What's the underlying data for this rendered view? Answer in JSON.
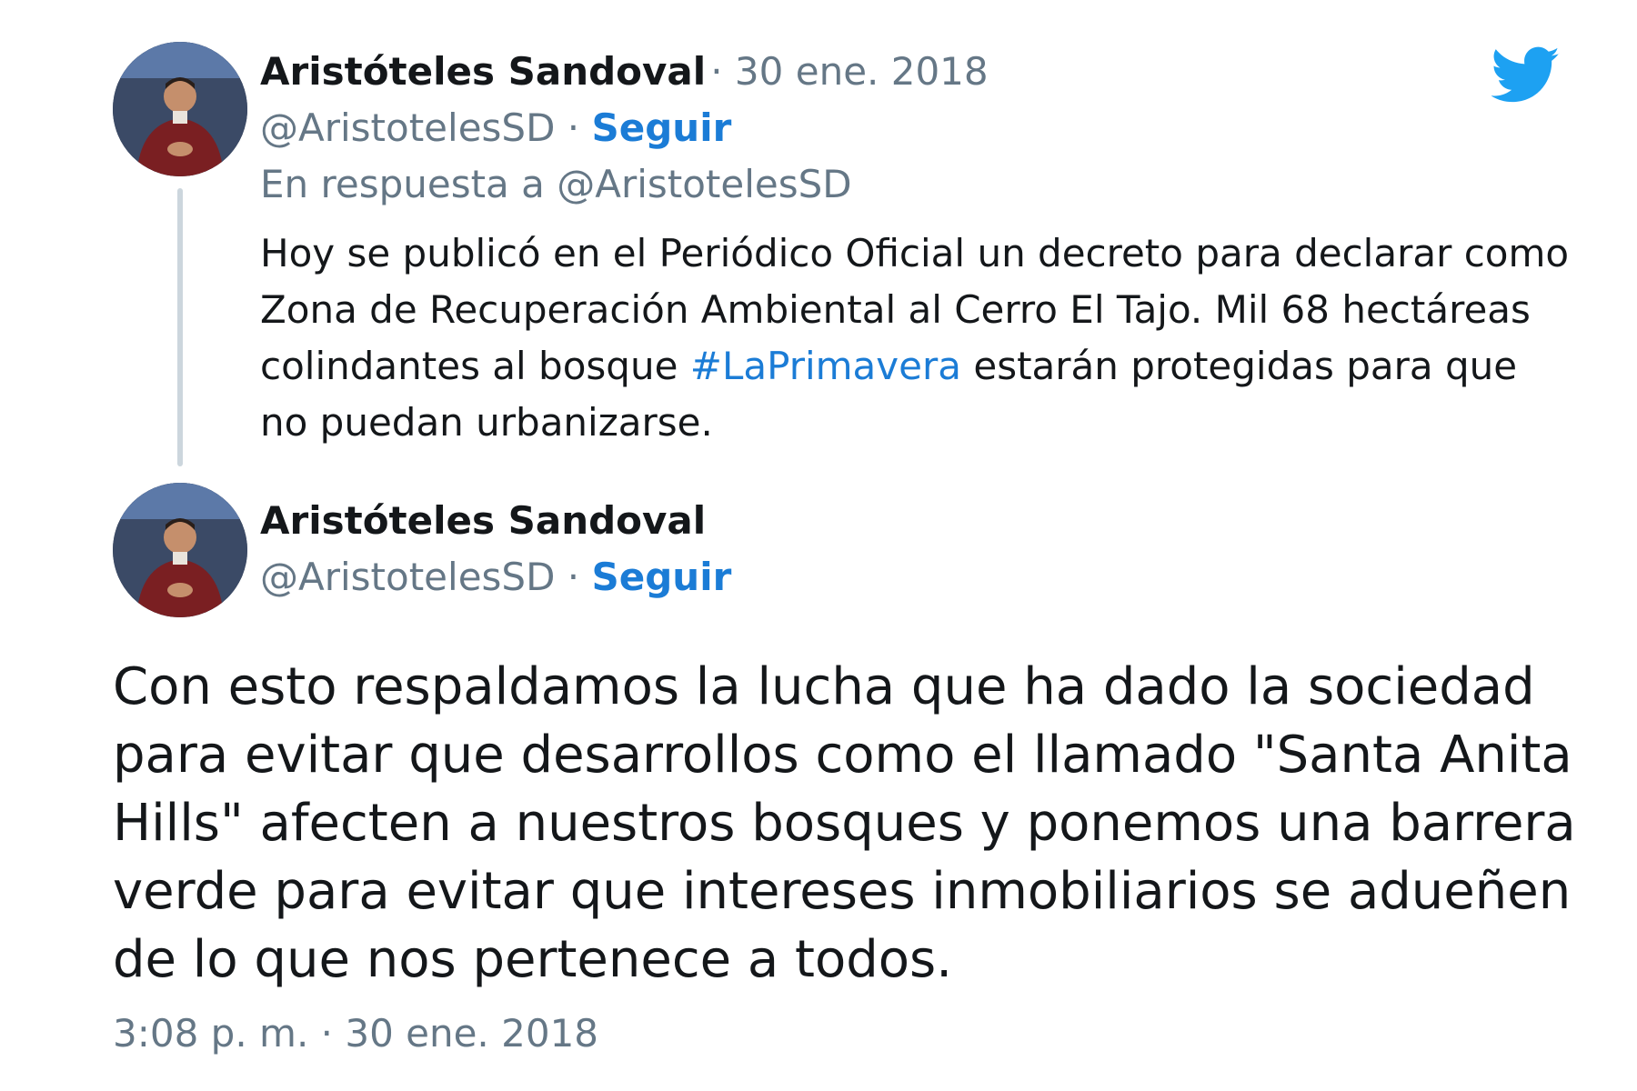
{
  "brand": {
    "icon": "twitter-bird-icon",
    "color": "#1da1f2"
  },
  "parent_tweet": {
    "avatar": "avatar-photo",
    "author_name": "Aristóteles Sandoval",
    "separator_date": "· 30 ene. 2018",
    "handle": "@AristotelesSD",
    "dot": "·",
    "follow_label": "Seguir",
    "reply_context": "En respuesta a @AristotelesSD",
    "text_before_hashtag": "Hoy se publicó en el Periódico Oficial un decreto para declarar como Zona de Recuperación Ambiental al Cerro El Tajo. Mil 68 hectáreas colindantes al bosque ",
    "hashtag": "#LaPrimavera",
    "text_after_hashtag": " estarán protegidas para que no puedan urbanizarse."
  },
  "main_tweet": {
    "avatar": "avatar-photo",
    "author_name": "Aristóteles Sandoval",
    "handle": "@AristotelesSD",
    "dot": "·",
    "follow_label": "Seguir",
    "text": "Con esto respaldamos la lucha que ha dado la sociedad para evitar que desarrollos como el llamado \"Santa Anita Hills\" afecten a nuestros bosques y ponemos una barrera verde para evitar que intereses inmobiliarios se adueñen de lo que nos pertenece a todos.",
    "timestamp": "3:08 p. m. · 30 ene. 2018"
  },
  "colors": {
    "text": "#14171a",
    "secondary": "#657786",
    "link": "#1b7cd6",
    "thread_line": "#ccd6dd"
  }
}
